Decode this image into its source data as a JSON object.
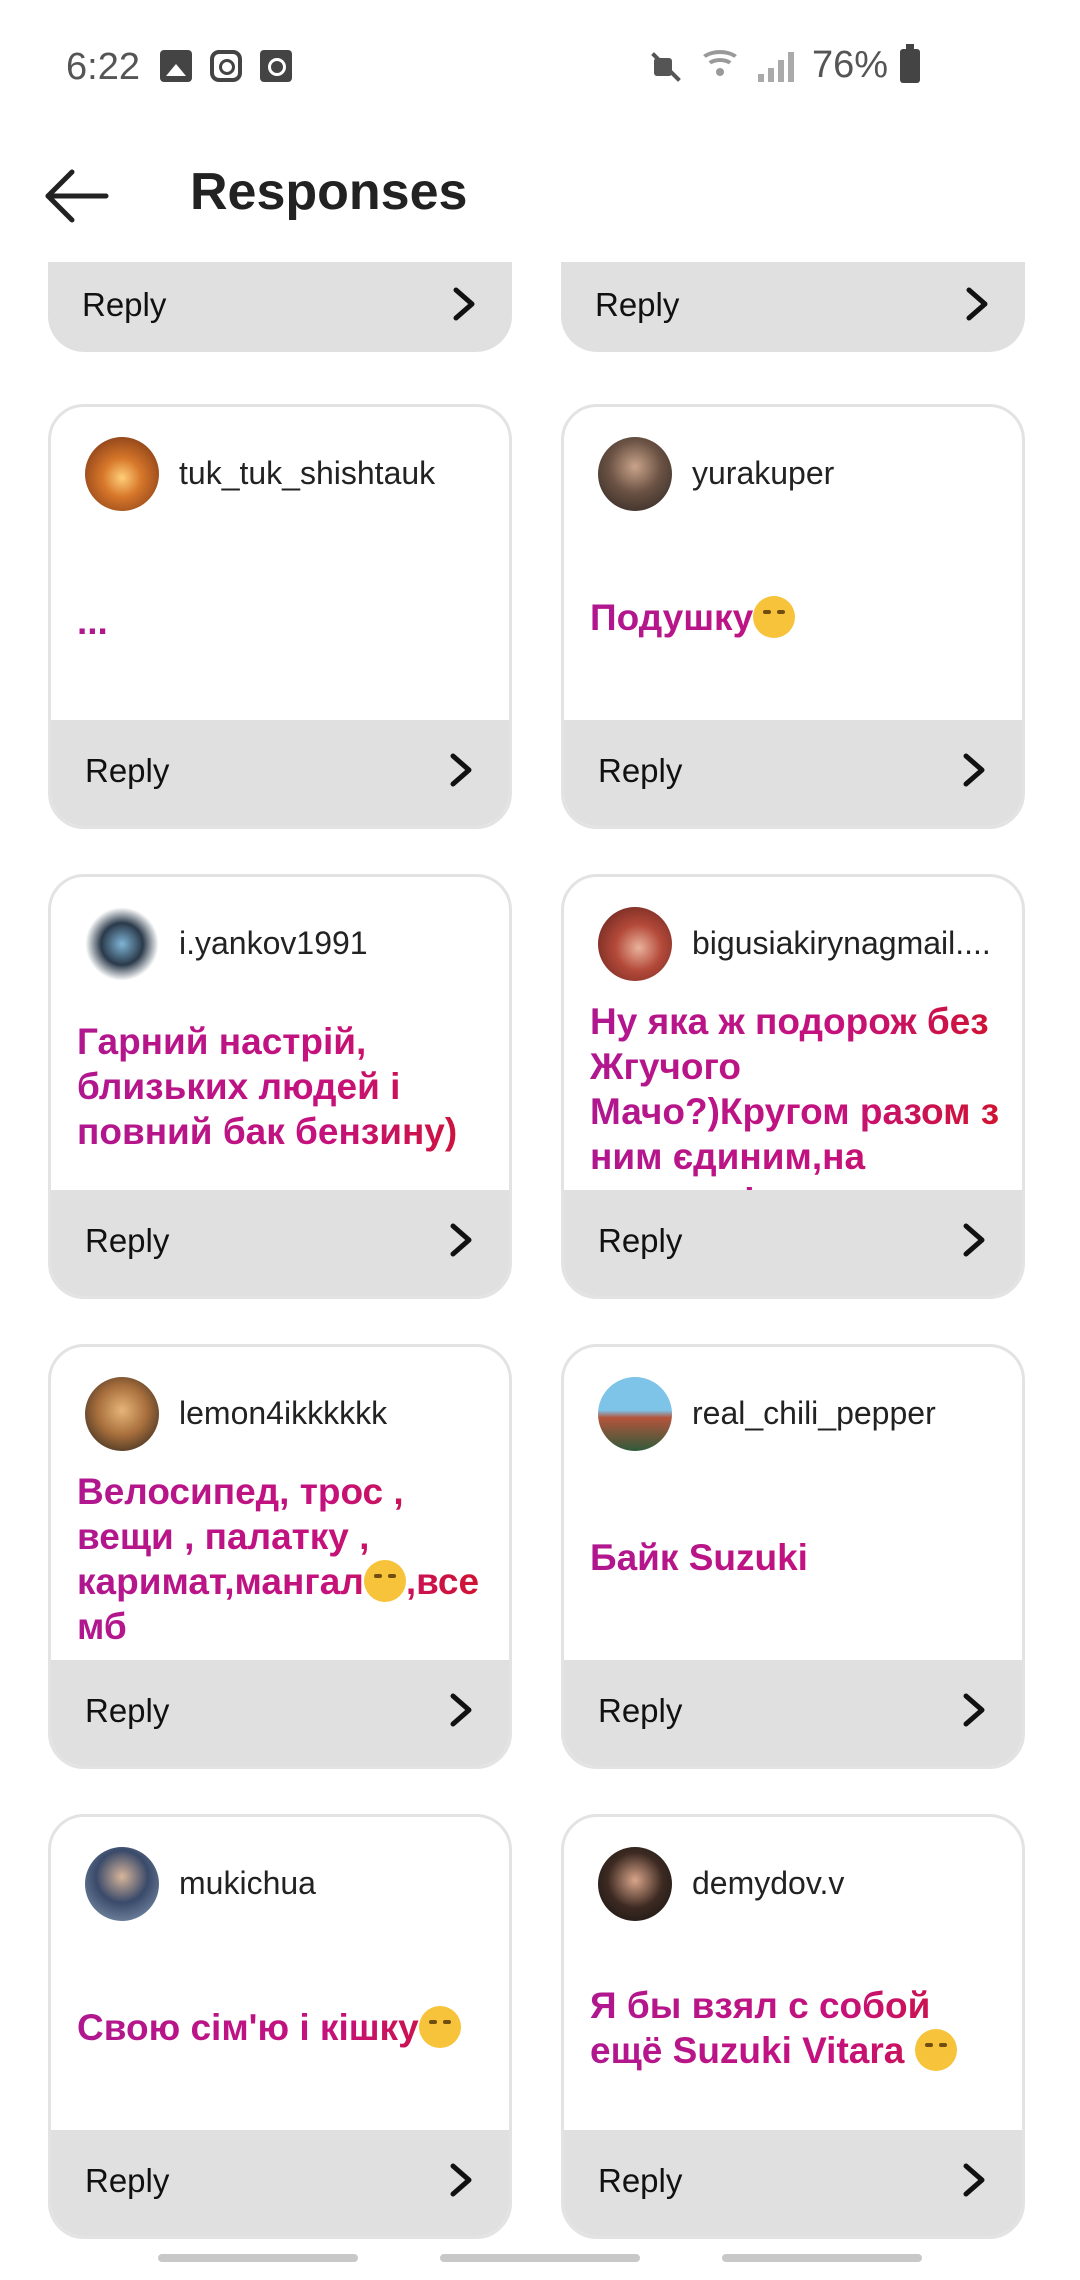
{
  "status_bar": {
    "time": "6:22",
    "battery": "76%"
  },
  "header": {
    "title": "Responses",
    "back_icon": "arrow-left-icon"
  },
  "reply_label": "Reply",
  "top_partial": [
    {
      "reply": "Reply"
    },
    {
      "reply": "Reply"
    }
  ],
  "responses": [
    {
      "username": "tuk_tuk_shishtauk",
      "message": "...",
      "reply": "Reply"
    },
    {
      "username": "yurakuper",
      "message": "Подушку",
      "emoji": "sleeping-face-icon",
      "reply": "Reply"
    },
    {
      "username": "i.yankov1991",
      "message": "Гарний настрій, близьких людей і повний бак бензину)",
      "reply": "Reply"
    },
    {
      "username": "bigusiakirynagmail....",
      "message": "Ну яка ж подорож без Жгучого Мачо?)Кругом разом з ним єдиним,на лисицю і на вистави",
      "reply": "Reply"
    },
    {
      "username": "lemon4ikkkkkk",
      "message_a": "Велосипед, трос , вещи , палатку , каримат,мангал",
      "message_b": ",все мб",
      "emoji": "grinning-sweat-icon",
      "reply": "Reply"
    },
    {
      "username": "real_chili_pepper",
      "message": "Байк Suzuki",
      "reply": "Reply"
    },
    {
      "username": "mukichua",
      "message": "Свою сім'ю і кішку",
      "emoji": "relieved-face-icon",
      "reply": "Reply"
    },
    {
      "username": "demydov.v",
      "message": "Я бы взял с собой ещё Suzuki Vitara ",
      "emoji": "grinning-squint-icon",
      "reply": "Reply"
    }
  ],
  "colors": {
    "accent_gradient_start": "#b0178f",
    "accent_gradient_end": "#d0132e",
    "footer_bg": "#e0e0e0"
  }
}
